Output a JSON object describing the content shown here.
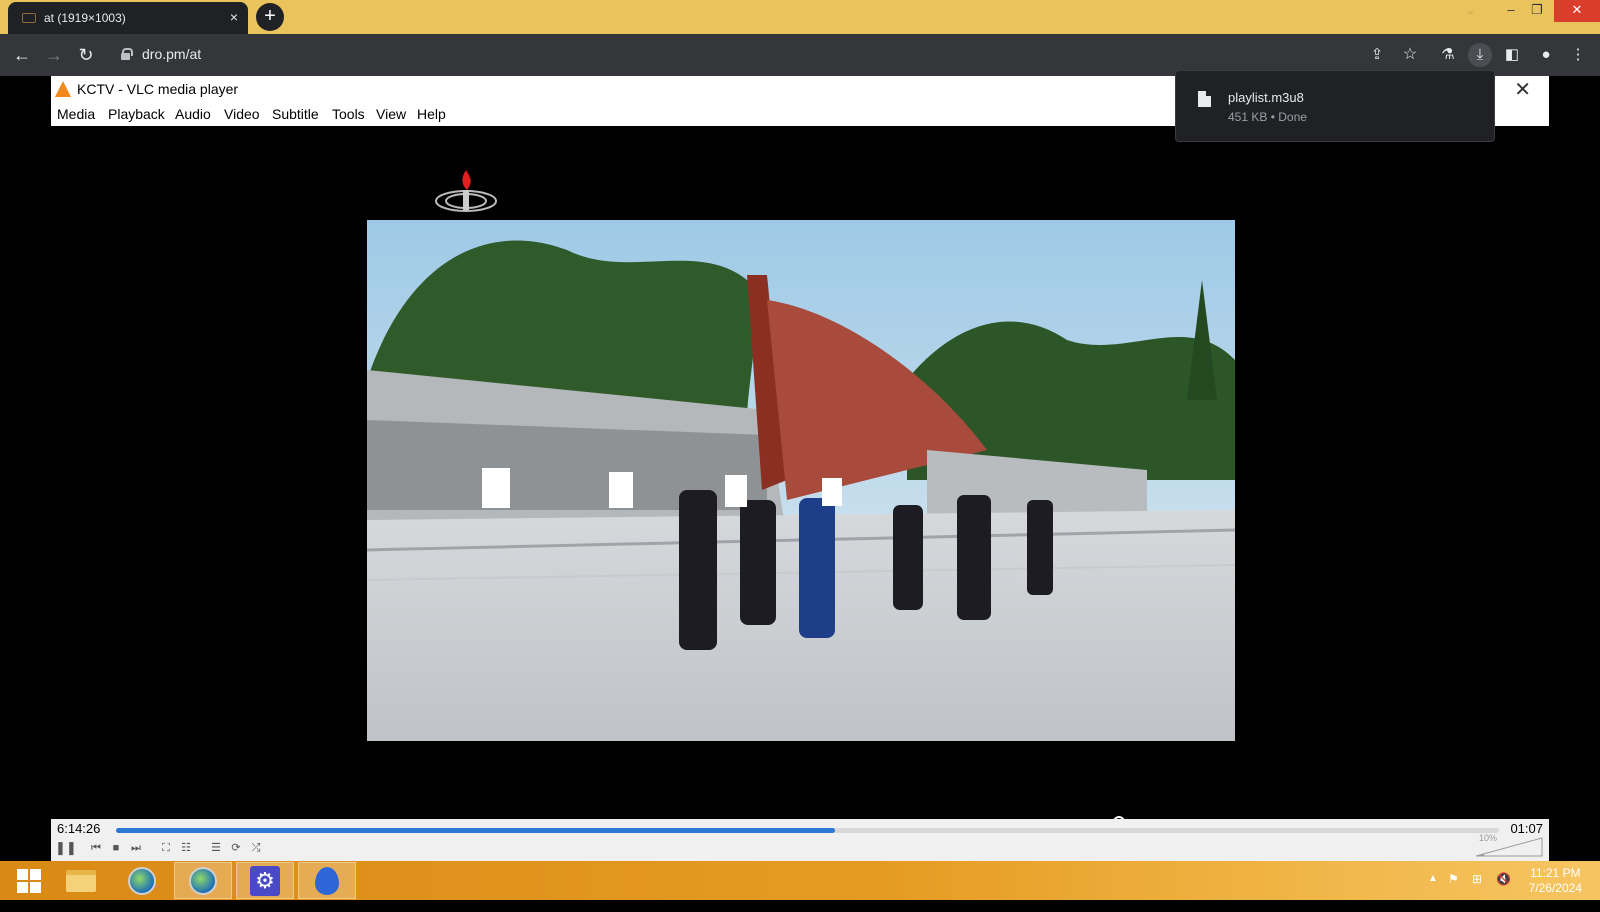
{
  "browser": {
    "tab_title": "at (1919×1003)",
    "tab_close": "×",
    "new_tab": "+",
    "url": "dro.pm/at"
  },
  "vlc": {
    "window_title": "KCTV - VLC media player",
    "menu": [
      "Media",
      "Playback",
      "Audio",
      "Video",
      "Subtitle",
      "Tools",
      "View",
      "Help"
    ],
    "time_elapsed": "6:14:26",
    "time_total": "01:07",
    "progress": 0.52,
    "volume_label": "10%"
  },
  "download": {
    "filename": "playlist.m3u8",
    "meta": "451 KB • Done"
  },
  "taskbar": {
    "time": "11:21 PM",
    "date": "7/26/2024"
  },
  "colors": {
    "tabstrip": "#e9c45d",
    "seek_fill": "#2d78d0"
  }
}
